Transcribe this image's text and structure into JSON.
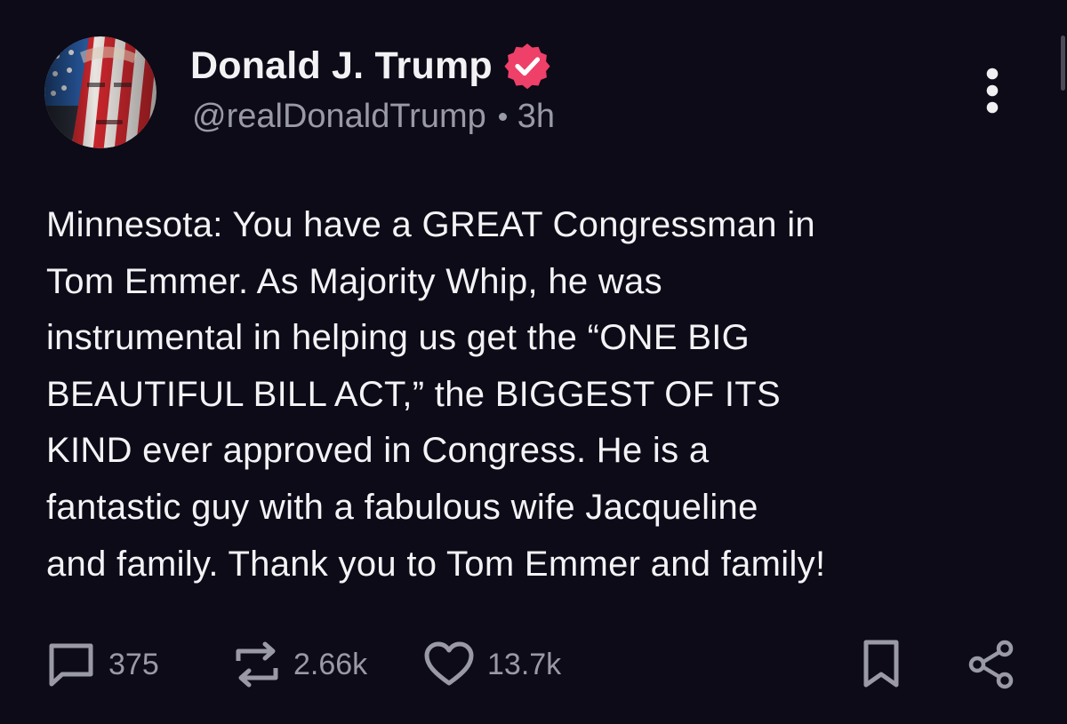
{
  "post": {
    "author": {
      "display_name": "Donald J. Trump",
      "handle": "@realDonaldTrump",
      "time_ago": "3h",
      "verified": true,
      "avatar_icon": "flag-face-avatar"
    },
    "text_lines": [
      "Minnesota: You have a GREAT Congressman in",
      "Tom Emmer. As Majority Whip, he was",
      "instrumental in helping us get the “ONE BIG",
      "BEAUTIFUL BILL ACT,” the BIGGEST OF ITS",
      "KIND ever approved in Congress. He is a",
      "fantastic guy with a fabulous wife Jacqueline",
      "and family. Thank you to Tom Emmer and family!"
    ],
    "actions": {
      "replies": {
        "icon": "comment-icon",
        "count": "375"
      },
      "reposts": {
        "icon": "repost-icon",
        "count": "2.66k"
      },
      "likes": {
        "icon": "heart-icon",
        "count": "13.7k"
      },
      "bookmark": {
        "icon": "bookmark-icon"
      },
      "share": {
        "icon": "share-icon"
      }
    }
  },
  "colors": {
    "background": "#0c0b17",
    "text": "#f3f3f6",
    "muted": "#9a99a6",
    "verified_badge": "#ee4068"
  }
}
